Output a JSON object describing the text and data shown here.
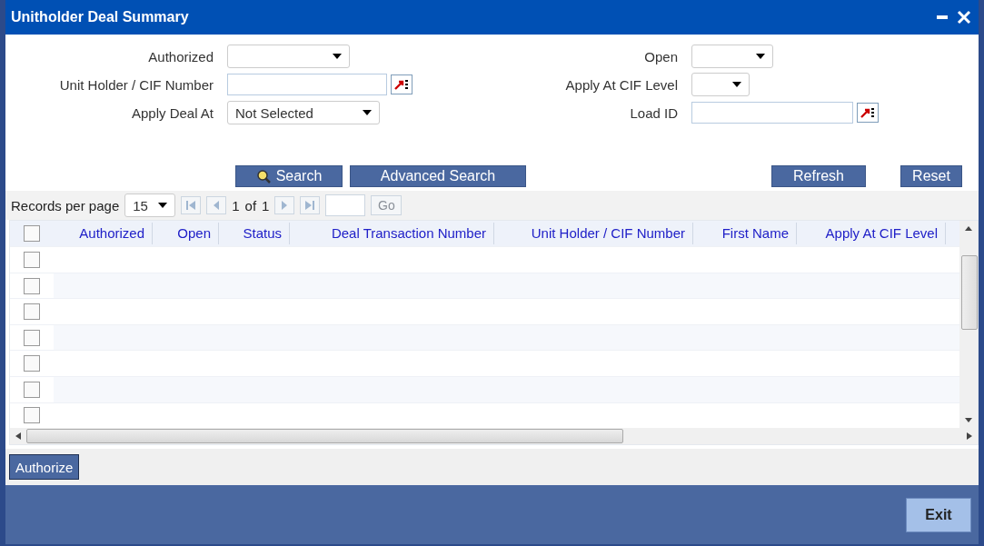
{
  "window": {
    "title": "Unitholder Deal Summary"
  },
  "form": {
    "left": [
      {
        "label": "Authorized",
        "kind": "select"
      },
      {
        "label": "Unit Holder / CIF Number",
        "kind": "lookup"
      },
      {
        "label": "Apply Deal At",
        "kind": "select",
        "value": "Not Selected"
      }
    ],
    "right": [
      {
        "label": "Open",
        "kind": "select"
      },
      {
        "label": "Apply At CIF Level",
        "kind": "select"
      },
      {
        "label": "Load ID",
        "kind": "lookup"
      }
    ]
  },
  "actions": {
    "search": "Search",
    "advanced_search": "Advanced Search",
    "refresh": "Refresh",
    "reset": "Reset"
  },
  "pager": {
    "label": "Records per page",
    "per_page": "15",
    "current": "1",
    "of": "of",
    "total": "1",
    "go": {
      "label": "Go",
      "disabled": true
    }
  },
  "table": {
    "header_checked": false,
    "columns": [
      "Authorized",
      "Open",
      "Status",
      "Deal Transaction Number",
      "Unit Holder / CIF Number",
      "First Name",
      "Apply At CIF Level"
    ],
    "rows": [
      {
        "checked": false
      },
      {
        "checked": false
      },
      {
        "checked": false
      },
      {
        "checked": false
      },
      {
        "checked": false
      },
      {
        "checked": false
      },
      {
        "checked": false
      }
    ]
  },
  "bottom": {
    "authorize": "Authorize",
    "exit": "Exit"
  }
}
